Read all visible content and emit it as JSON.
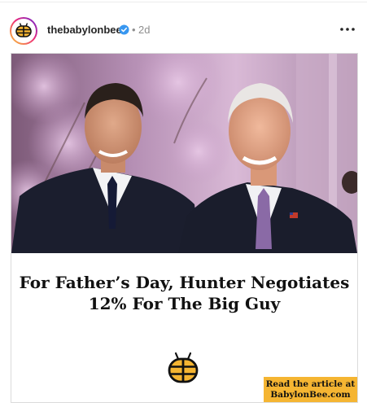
{
  "post": {
    "username": "thebabylonbee",
    "separator": "•",
    "time_ago": "2d",
    "more_icon": "more-horizontal-icon",
    "verified_icon": "verified-badge-icon",
    "verified_color": "#3897f0"
  },
  "article": {
    "headline_line1": "For Father’s Day, Hunter Negotiates",
    "headline_line2": "12% For The Big Guy",
    "cta_line1": "Read the article at",
    "cta_line2": "BabylonBee.com",
    "cta_color": "#f5b532",
    "logo_icon": "babylon-bee-logo-icon"
  }
}
